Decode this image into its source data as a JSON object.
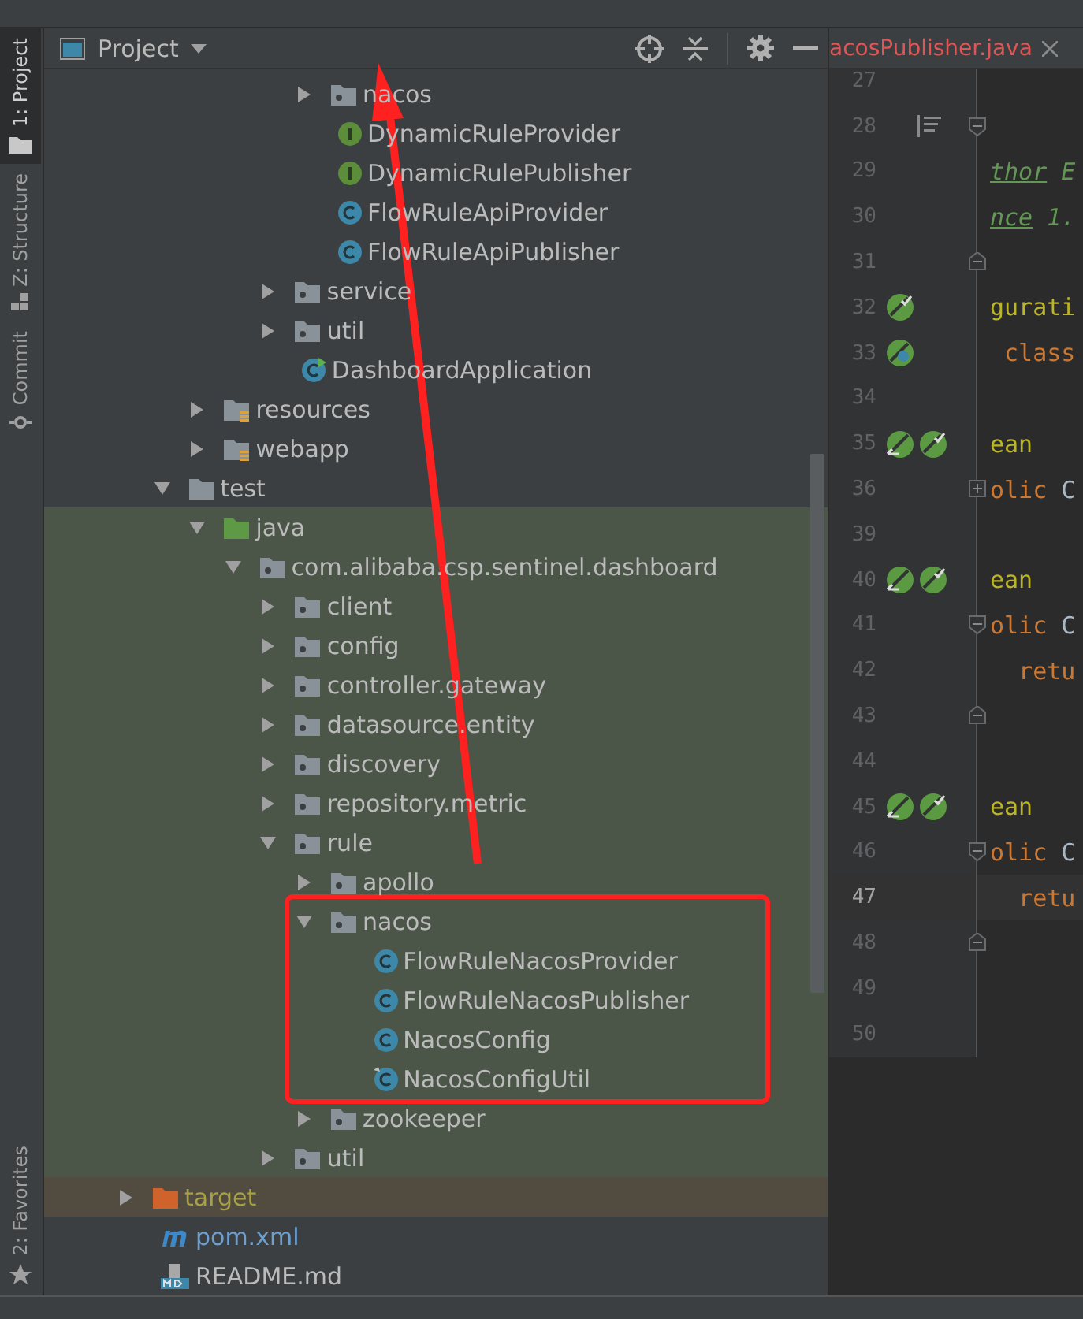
{
  "tool_strip": {
    "top": [
      {
        "label": "1: Project",
        "selected": true,
        "kind": "folder"
      },
      {
        "label": "Z: Structure",
        "selected": false,
        "kind": "structure"
      },
      {
        "label": "Commit",
        "selected": false,
        "kind": "commit"
      }
    ],
    "bottom": [
      {
        "label": "2: Favorites",
        "selected": false,
        "kind": "star"
      }
    ]
  },
  "project_panel": {
    "title": "Project",
    "tree": [
      {
        "children": [
          {
            "children": [
              {
                "children": [
                  {
                    "children": [
                      {
                        "children": [
                          {
                            "label": "nacos",
                            "kind": "package",
                            "expanded": false
                          },
                          {
                            "label": "DynamicRuleProvider",
                            "kind": "interface"
                          },
                          {
                            "label": "DynamicRulePublisher",
                            "kind": "interface"
                          },
                          {
                            "label": "FlowRuleApiProvider",
                            "kind": "class"
                          },
                          {
                            "label": "FlowRuleApiPublisher",
                            "kind": "class"
                          }
                        ]
                      },
                      {
                        "label": "service",
                        "kind": "package",
                        "expanded": false
                      },
                      {
                        "label": "util",
                        "kind": "package",
                        "expanded": false
                      },
                      {
                        "label": "DashboardApplication",
                        "kind": "boot-class"
                      }
                    ]
                  }
                ]
              },
              {
                "label": "resources",
                "kind": "resource-folder",
                "expanded": false
              },
              {
                "label": "webapp",
                "kind": "resource-folder",
                "expanded": false
              }
            ]
          },
          {
            "label": "test",
            "kind": "folder",
            "expanded": true,
            "children": [
              {
                "label": "java",
                "kind": "test-root",
                "expanded": true,
                "children": [
                  {
                    "label": "com.alibaba.csp.sentinel.dashboard",
                    "kind": "package",
                    "expanded": true,
                    "children": [
                      {
                        "label": "client",
                        "kind": "package",
                        "expanded": false
                      },
                      {
                        "label": "config",
                        "kind": "package",
                        "expanded": false
                      },
                      {
                        "label": "controller.gateway",
                        "kind": "package",
                        "expanded": false
                      },
                      {
                        "label": "datasource.entity",
                        "kind": "package",
                        "expanded": false
                      },
                      {
                        "label": "discovery",
                        "kind": "package",
                        "expanded": false
                      },
                      {
                        "label": "repository.metric",
                        "kind": "package",
                        "expanded": false
                      },
                      {
                        "label": "rule",
                        "kind": "package",
                        "expanded": true,
                        "children": [
                          {
                            "label": "apollo",
                            "kind": "package",
                            "expanded": false
                          },
                          {
                            "label": "nacos",
                            "kind": "package",
                            "expanded": true,
                            "children": [
                              {
                                "label": "FlowRuleNacosProvider",
                                "kind": "class"
                              },
                              {
                                "label": "FlowRuleNacosPublisher",
                                "kind": "class"
                              },
                              {
                                "label": "NacosConfig",
                                "kind": "class"
                              },
                              {
                                "label": "NacosConfigUtil",
                                "kind": "class-modified"
                              }
                            ]
                          },
                          {
                            "label": "zookeeper",
                            "kind": "package",
                            "expanded": false
                          }
                        ]
                      },
                      {
                        "label": "util",
                        "kind": "package",
                        "expanded": false
                      }
                    ]
                  }
                ]
              }
            ]
          }
        ]
      },
      {
        "label": "target",
        "kind": "excluded-folder",
        "expanded": false
      },
      {
        "label": "pom.xml",
        "kind": "maven"
      },
      {
        "label": "README.md",
        "kind": "markdown"
      }
    ]
  },
  "editor": {
    "tab": {
      "label": "acosPublisher.java"
    },
    "lines": [
      {
        "number": "27"
      },
      {
        "number": "28",
        "gutter": [
          {
            "kind": "structure"
          }
        ],
        "fold": {
          "kind": "start"
        }
      },
      {
        "number": "29",
        "segments": [
          {
            "kind": "doc-tag",
            "text": "thor"
          },
          {
            "kind": "doc",
            "text": " E"
          }
        ]
      },
      {
        "number": "30",
        "segments": [
          {
            "kind": "doc-tag",
            "text": "nce"
          },
          {
            "kind": "doc",
            "text": " 1."
          }
        ]
      },
      {
        "number": "31",
        "fold": {
          "kind": "end"
        }
      },
      {
        "number": "32",
        "segments": [
          {
            "kind": "annotation",
            "text": "gurati"
          }
        ],
        "gutter": [
          {
            "kind": "bean"
          }
        ]
      },
      {
        "number": "33",
        "segments": [
          {
            "kind": "keyword",
            "text": " class"
          }
        ],
        "gutter": [
          {
            "kind": "bean-search"
          }
        ]
      },
      {
        "number": "34"
      },
      {
        "number": "35",
        "segments": [
          {
            "kind": "annotation",
            "text": "ean"
          }
        ],
        "gutter": [
          {
            "kind": "bean-link"
          },
          {
            "kind": "bean"
          }
        ]
      },
      {
        "number": "36",
        "segments": [
          {
            "kind": "keyword",
            "text": "olic"
          },
          {
            "kind": "plain",
            "text": " C"
          }
        ],
        "fold": {
          "kind": "collapsed"
        }
      },
      {
        "number": "39"
      },
      {
        "number": "40",
        "segments": [
          {
            "kind": "annotation",
            "text": "ean"
          }
        ],
        "gutter": [
          {
            "kind": "bean-link"
          },
          {
            "kind": "bean"
          }
        ]
      },
      {
        "number": "41",
        "segments": [
          {
            "kind": "keyword",
            "text": "olic"
          },
          {
            "kind": "plain",
            "text": " C"
          }
        ],
        "fold": {
          "kind": "start"
        }
      },
      {
        "number": "42",
        "segments": [
          {
            "kind": "keyword",
            "text": "  retu"
          }
        ]
      },
      {
        "number": "43",
        "fold": {
          "kind": "end"
        }
      },
      {
        "number": "44"
      },
      {
        "number": "45",
        "segments": [
          {
            "kind": "annotation",
            "text": "ean"
          }
        ],
        "gutter": [
          {
            "kind": "bean-link"
          },
          {
            "kind": "bean"
          }
        ]
      },
      {
        "number": "46",
        "segments": [
          {
            "kind": "keyword",
            "text": "olic"
          },
          {
            "kind": "plain",
            "text": " C"
          }
        ],
        "fold": {
          "kind": "start"
        }
      },
      {
        "number": "47",
        "segments": [
          {
            "kind": "keyword",
            "text": "  retu"
          }
        ],
        "current": true
      },
      {
        "number": "48",
        "fold": {
          "kind": "end"
        }
      },
      {
        "number": "49"
      },
      {
        "number": "50"
      }
    ]
  },
  "annotations": {
    "arrow": true,
    "box": true
  }
}
